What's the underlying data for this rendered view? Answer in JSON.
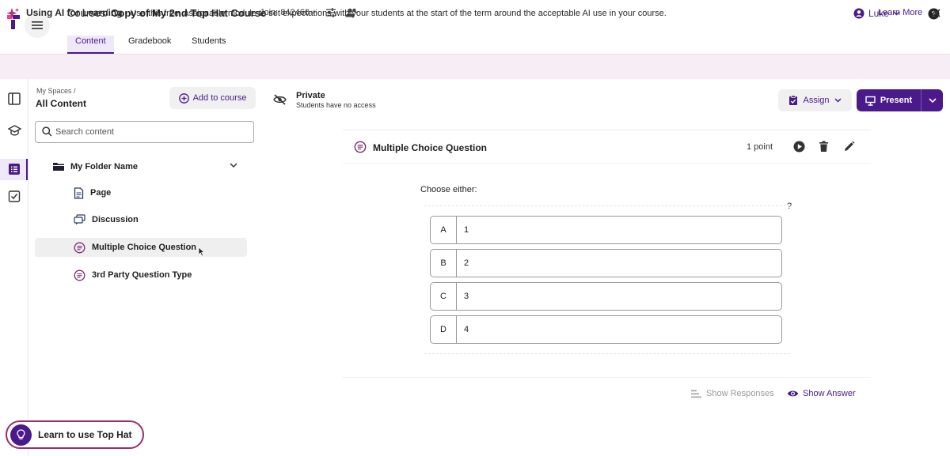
{
  "header": {
    "breadcrumb_root": "Courses",
    "breadcrumb_sep": "/",
    "course_title": "Copy of My 2nd Top Hat Course",
    "join_code": "Join: 842460",
    "user_name": "Luke"
  },
  "tabs": [
    {
      "label": "Content",
      "active": true
    },
    {
      "label": "Gradebook",
      "active": false
    },
    {
      "label": "Students",
      "active": false
    }
  ],
  "banner": {
    "title": "Using AI for Learning",
    "text": " - Use this free, assignable module to set expectations with your students at the start of the term around the acceptable AI use in your course.",
    "link": "Learn More"
  },
  "content_panel": {
    "spaces_crumb": "My Spaces /",
    "title": "All Content",
    "add_button": "Add to course",
    "search_placeholder": "Search content",
    "folder_name": "My Folder Name",
    "items": [
      {
        "label": "Page",
        "icon": "page-icon"
      },
      {
        "label": "Discussion",
        "icon": "discussion-icon"
      },
      {
        "label": "Multiple Choice Question",
        "icon": "question-icon",
        "selected": true
      },
      {
        "label": "3rd Party Question Type",
        "icon": "question-icon"
      }
    ]
  },
  "visibility": {
    "title": "Private",
    "subtitle": "Students have no access"
  },
  "actions": {
    "assign": "Assign",
    "present": "Present"
  },
  "question": {
    "title": "Multiple Choice Question",
    "points": "1 point",
    "prompt": "Choose either:",
    "help": "?",
    "choices": [
      {
        "letter": "A",
        "value": "1"
      },
      {
        "letter": "B",
        "value": "2"
      },
      {
        "letter": "C",
        "value": "3"
      },
      {
        "letter": "D",
        "value": "4"
      }
    ],
    "show_responses": "Show Responses",
    "show_answer": "Show Answer"
  },
  "learn_pill": "Learn to use Top Hat",
  "colors": {
    "accent": "#4b1a8a",
    "banner_bg": "#f6eef4",
    "pill_border": "#9b2c6f"
  }
}
